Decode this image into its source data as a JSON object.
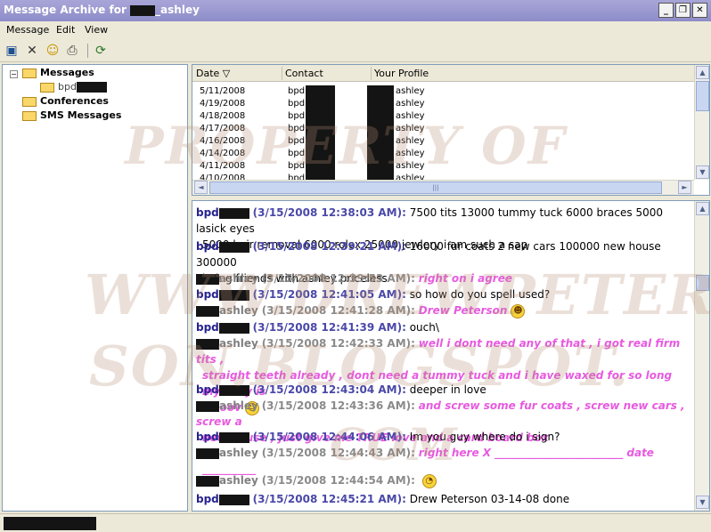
{
  "window": {
    "title_prefix": "Message Archive for ",
    "title_suffix": "_ashley",
    "controls": [
      "minimize",
      "maximize",
      "close"
    ],
    "minimize_glyph": "_",
    "maximize_glyph": "❐",
    "close_glyph": "✕"
  },
  "menu": {
    "message": "Message",
    "edit": "Edit",
    "view": "View"
  },
  "toolbar": {
    "icons": [
      "save-icon",
      "delete-icon",
      "search-people-icon",
      "print-icon",
      "refresh-icon"
    ],
    "glyphs": {
      "save": "▣",
      "delete": "✕",
      "search": "☺",
      "print": "⎙",
      "refresh": "⟳"
    }
  },
  "tree": {
    "root": "Messages",
    "child": "bpd",
    "conferences": "Conferences",
    "sms": "SMS Messages",
    "expander": "−"
  },
  "list": {
    "columns": {
      "date": "Date ▽",
      "contact": "Contact",
      "profile": "Your Profile"
    },
    "rows": [
      {
        "date": "5/11/2008",
        "contact": "bpd",
        "profile": "ashley"
      },
      {
        "date": "4/19/2008",
        "contact": "bpd",
        "profile": "ashley"
      },
      {
        "date": "4/18/2008",
        "contact": "bpd",
        "profile": "ashley"
      },
      {
        "date": "4/17/2008",
        "contact": "bpd",
        "profile": "ashley"
      },
      {
        "date": "4/16/2008",
        "contact": "bpd",
        "profile": "ashley"
      },
      {
        "date": "4/14/2008",
        "contact": "bpd",
        "profile": "ashley"
      },
      {
        "date": "4/11/2008",
        "contact": "bpd",
        "profile": "ashley"
      },
      {
        "date": "4/10/2008",
        "contact": "bpd",
        "profile": "ashley"
      }
    ]
  },
  "chat": {
    "messages": [
      {
        "from": "bpd",
        "time": "(3/15/2008 12:38:03 AM):",
        "text1": "7500 tits 13000 tummy tuck 6000 braces 5000 lasick eyes",
        "text2": "5000 hair removal 6000 rolex 25000 jewlery i am such a sap"
      },
      {
        "from": "bpd",
        "time": "(3/15/2008 12:39:21 AM):",
        "text1": "16000 fur coats 2 new cars 100000 new house 300000",
        "text2": "being friends with ashley priceless"
      },
      {
        "from": "ashley",
        "time": "(3/15/2008 12:39:53 AM):",
        "text1": "right on i agree"
      },
      {
        "from": "bpd",
        "time": "(3/15/2008 12:41:05 AM):",
        "text1": "so how do you spell used?"
      },
      {
        "from": "ashley",
        "time": "(3/15/2008 12:41:28 AM):",
        "text1": "Drew Peterson"
      },
      {
        "from": "bpd",
        "time": "(3/15/2008 12:41:39 AM):",
        "text1": "ouch\\"
      },
      {
        "from": "ashley",
        "time": "(3/15/2008 12:42:33 AM):",
        "text1": "well i dont need any of that , i got real firm tits ,",
        "text2": "straight teeth already , dont need a tummy tuck and i have waxed for so long my kitty is",
        "text3": "smoov"
      },
      {
        "from": "bpd",
        "time": "(3/15/2008 12:43:04 AM):",
        "text1": "deeper in love"
      },
      {
        "from": "ashley",
        "time": "(3/15/2008 12:43:36 AM):",
        "text1": "and screw some fur coats , screw new cars , screw a",
        "text2": "new house , just give me TRUE love and a card board box"
      },
      {
        "from": "bpd",
        "time": "(3/15/2008 12:44:06 AM):",
        "text1": "Im you guy where do i sign?"
      },
      {
        "from": "ashley",
        "time": "(3/15/2008 12:44:43 AM):",
        "text1": "right here X ________________________ date",
        "text2": "__________"
      },
      {
        "from": "ashley",
        "time": "(3/15/2008 12:44:54 AM):",
        "text1": ""
      },
      {
        "from": "bpd",
        "time": "(3/15/2008 12:45:21 AM):",
        "text1": "Drew Peterson 03-14-08 done"
      }
    ],
    "emoticons": {
      "grin": "☻",
      "tongue": "☺",
      "roll": "◔"
    }
  },
  "scroll": {
    "up": "▲",
    "down": "▼",
    "left": "◄",
    "right": "►",
    "grip": "|||"
  },
  "watermark": {
    "line1": "PROPERTY OF",
    "line2": "WWW.DREWPETER",
    "line3": "SON.BLOGSPOT.",
    "line4": "COM"
  },
  "colors": {
    "title_bar": "#9896d0",
    "bpd_name": "#26228f",
    "ashley_text": "#e75ae0"
  }
}
